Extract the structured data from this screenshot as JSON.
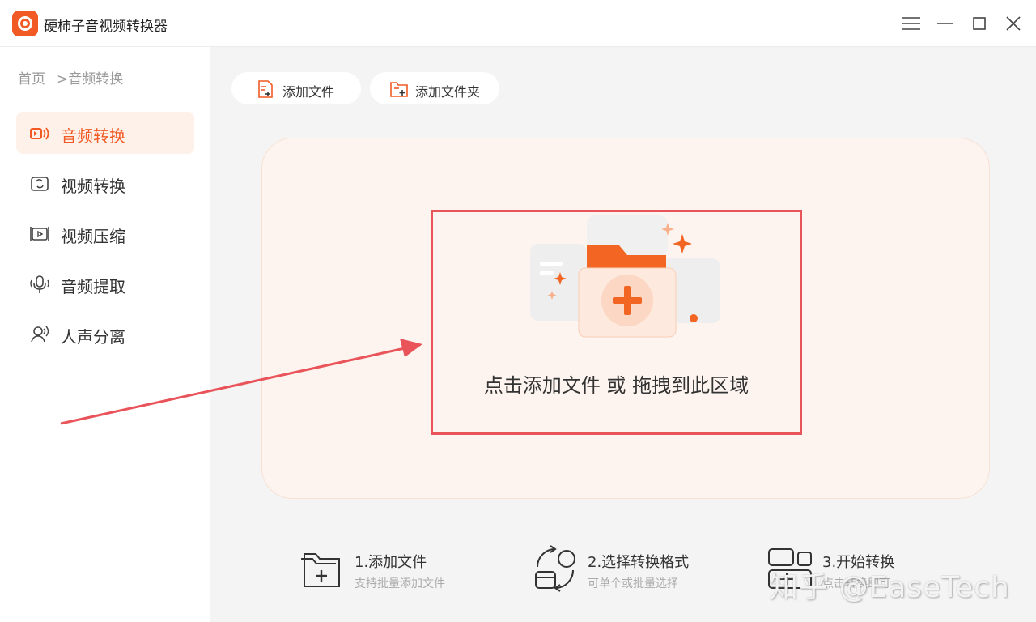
{
  "app": {
    "title": "硬柿子音视频转换器"
  },
  "colors": {
    "accent": "#f15a24",
    "highlight": "#e9535a",
    "panel_bg": "#fdf4ef",
    "main_bg": "#f4f4f4"
  },
  "window_controls": [
    "menu-icon",
    "minimize-icon",
    "maximize-icon",
    "close-icon"
  ],
  "breadcrumb": {
    "home": "首页",
    "current": ">音频转换"
  },
  "sidebar": {
    "items": [
      {
        "label": "音频转换",
        "icon": "audio-convert-icon",
        "active": true
      },
      {
        "label": "视频转换",
        "icon": "video-convert-icon",
        "active": false
      },
      {
        "label": "视频压缩",
        "icon": "video-compress-icon",
        "active": false
      },
      {
        "label": "音频提取",
        "icon": "audio-extract-icon",
        "active": false
      },
      {
        "label": "人声分离",
        "icon": "voice-separate-icon",
        "active": false
      }
    ]
  },
  "toolbar": {
    "add_file": "添加文件",
    "add_folder": "添加文件夹"
  },
  "dropzone": {
    "text": "点击添加文件 或 拖拽到此区域"
  },
  "steps": [
    {
      "title": "1.添加文件",
      "subtitle": "支持批量添加文件",
      "icon": "add-file-step-icon"
    },
    {
      "title": "2.选择转换格式",
      "subtitle": "可单个或批量选择",
      "icon": "select-format-step-icon"
    },
    {
      "title": "3.开始转换",
      "subtitle": "点击转换即可",
      "icon": "start-convert-step-icon"
    }
  ],
  "watermark": "知乎 @EaseTech"
}
